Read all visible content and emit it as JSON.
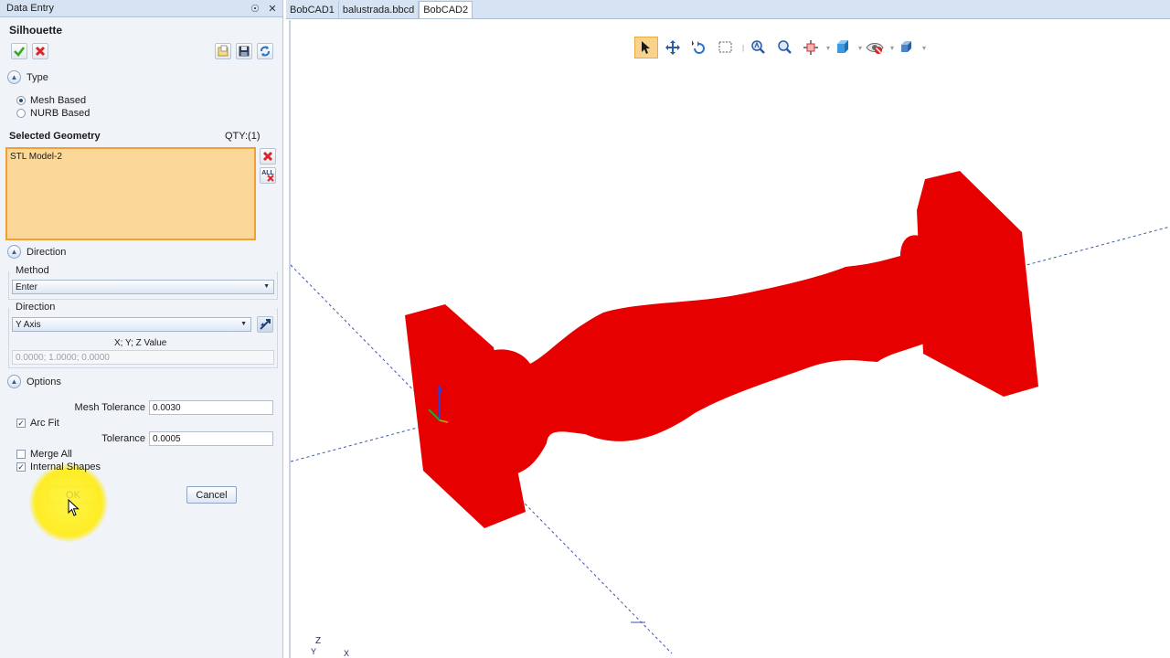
{
  "panel": {
    "title": "Data Entry",
    "pin_glyph": "☉",
    "close_glyph": "✕",
    "heading": "Silhouette",
    "type_section": "Type",
    "type_options": [
      {
        "label": "Mesh Based",
        "selected": true
      },
      {
        "label": "NURB Based",
        "selected": false
      }
    ],
    "selected_geometry_label": "Selected Geometry",
    "qty": "QTY:(1)",
    "geometry_items": [
      "STL Model-2"
    ],
    "remove_all_label": "ALL",
    "direction_section": "Direction",
    "method_label": "Method",
    "method_value": "Enter",
    "direction_label": "Direction",
    "direction_value": "Y Axis",
    "xyz_label": "X; Y; Z Value",
    "xyz_value": "0.0000; 1.0000; 0.0000",
    "options_section": "Options",
    "mesh_tolerance_label": "Mesh Tolerance",
    "mesh_tolerance_value": "0.0030",
    "arc_fit_label": "Arc Fit",
    "tolerance_label": "Tolerance",
    "tolerance_value": "0.0005",
    "merge_all_label": "Merge All",
    "internal_shapes_label": "Internal Shapes",
    "ok_label": "OK",
    "cancel_label": "Cancel",
    "check_glyph": "✓"
  },
  "tabs": [
    {
      "label": "BobCAD1",
      "active": false
    },
    {
      "label": "balustrada.bbcd",
      "active": false
    },
    {
      "label": "BobCAD2",
      "active": true
    }
  ],
  "axis_labels": {
    "z": "Z",
    "y": "Y",
    "x": "X"
  },
  "colors": {
    "model": "#e60000",
    "accent": "#f0a035",
    "selection_fill": "#fbd798",
    "axis_line": "#3b57a8"
  }
}
